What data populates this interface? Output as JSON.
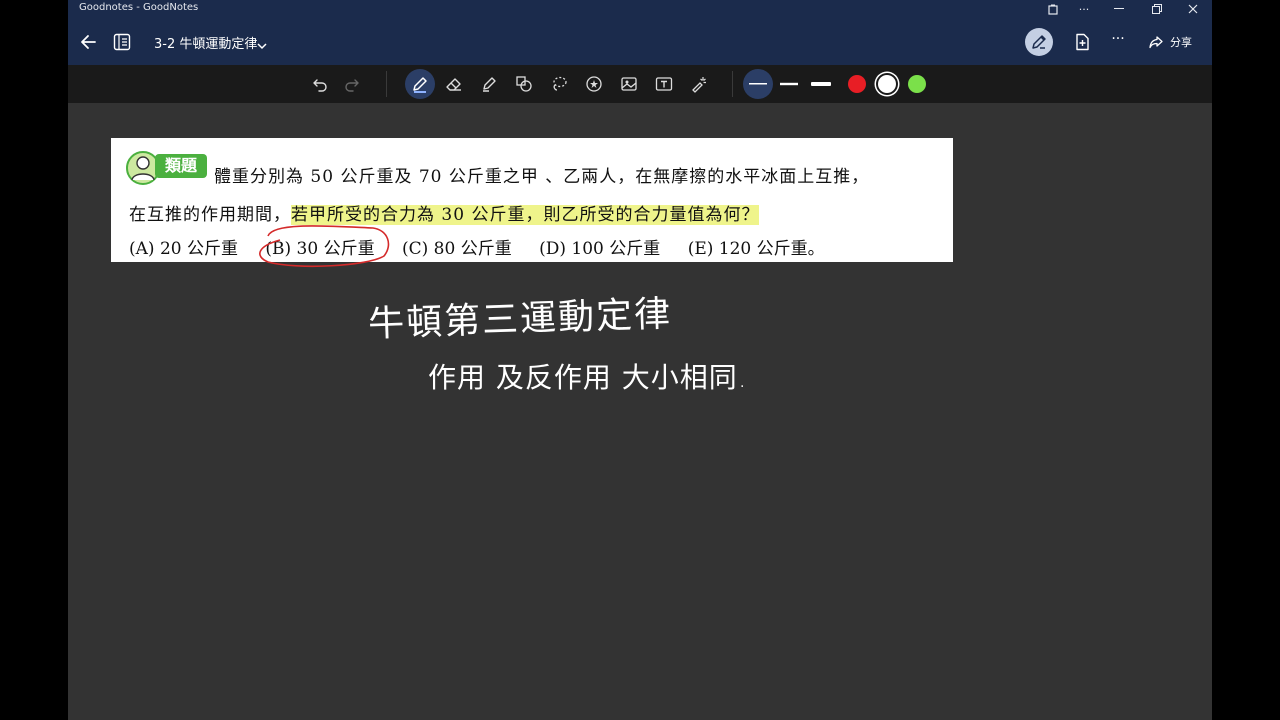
{
  "window": {
    "title": "Goodnotes - GoodNotes"
  },
  "header": {
    "doc_title": "3-2 牛頓運動定律",
    "share_label": "分享"
  },
  "toolbar": {
    "tools": [
      "undo-icon",
      "redo-icon",
      "pen-icon",
      "eraser-icon",
      "highlighter-icon",
      "shapes-icon",
      "lasso-icon",
      "sticker-icon",
      "image-icon",
      "textbox-icon",
      "laser-pointer-icon"
    ],
    "active_tool": "pen-icon",
    "stroke_widths": [
      "thin",
      "medium",
      "thick"
    ],
    "colors": [
      "#e81e25",
      "#ffffff",
      "#7be04a"
    ],
    "accent": "#2b3e66"
  },
  "page": {
    "badge": "類題",
    "question_line1": "體重分別為 50 公斤重及 70 公斤重之甲 、乙兩人，在無摩擦的水平冰面上互推，",
    "question_line2_a": "在互推的作用期間，",
    "question_line2_b": "若甲所受的合力為 30 公斤重",
    "question_line2_c": "，則乙所受的合力量值為何？",
    "options": [
      "(A) 20 公斤重",
      "(B) 30 公斤重",
      "(C) 80 公斤重",
      "(D) 100 公斤重",
      "(E) 120 公斤重。"
    ]
  },
  "handwriting": {
    "line1": "牛頓第三運動定律",
    "line2": "作用 及反作用  大小相同."
  }
}
